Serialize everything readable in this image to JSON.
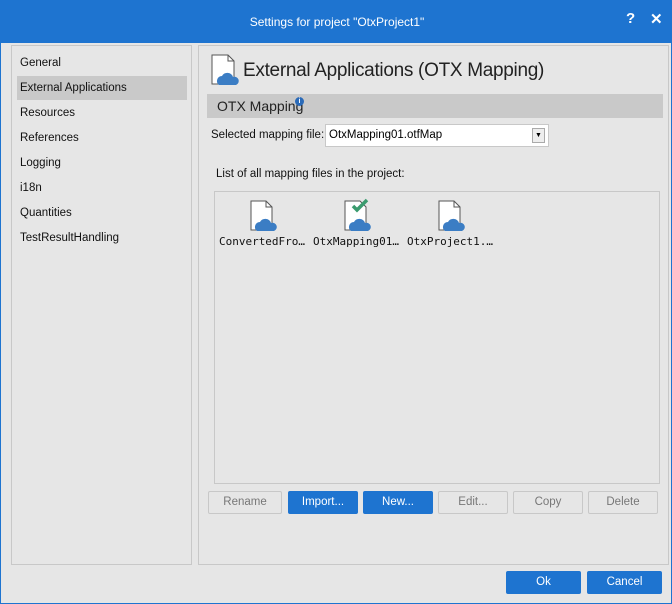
{
  "window": {
    "title": "Settings for project \"OtxProject1\"",
    "help_label": "?",
    "close_label": "✕"
  },
  "sidebar": {
    "items": [
      {
        "label": "General"
      },
      {
        "label": "External Applications",
        "active": true
      },
      {
        "label": "Resources"
      },
      {
        "label": "References"
      },
      {
        "label": "Logging"
      },
      {
        "label": "i18n"
      },
      {
        "label": "Quantities"
      },
      {
        "label": "TestResultHandling"
      }
    ]
  },
  "main": {
    "title": "External Applications (OTX Mapping)",
    "section": "OTX Mapping",
    "info_icon": "i",
    "select_label": "Selected mapping file:",
    "select_value": "OtxMapping01.otfMap",
    "list_label": "List of all mapping files in the project:",
    "files": [
      {
        "name": "ConvertedFro…",
        "checked": false
      },
      {
        "name": "OtxMapping01…",
        "checked": true
      },
      {
        "name": "OtxProject1.…",
        "checked": false
      }
    ],
    "buttons": {
      "rename": "Rename",
      "import": "Import...",
      "new": "New...",
      "edit": "Edit...",
      "copy": "Copy",
      "delete": "Delete"
    }
  },
  "footer": {
    "ok": "Ok",
    "cancel": "Cancel"
  },
  "colors": {
    "accent": "#1e74d0",
    "cloud": "#3b7dc4",
    "check": "#3a9b6e"
  }
}
